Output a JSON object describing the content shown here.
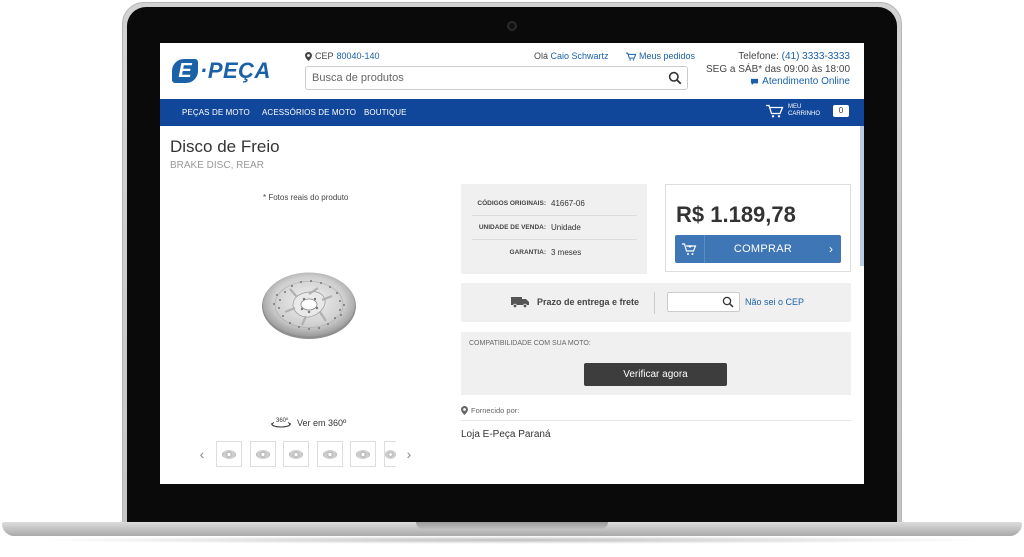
{
  "header": {
    "logo_e": "E",
    "logo_text": "·PEÇA",
    "cep_label": "CEP",
    "cep_value": "80040-140",
    "greeting_prefix": "Olá",
    "user_name": "Caio Schwartz",
    "orders_label": "Meus pedidos",
    "phone_label": "Telefone:",
    "phone_number": "(41) 3333-3333",
    "hours": "SEG a SÁB* das 09:00 às 18:00",
    "online_label": "Atendimento Online"
  },
  "search": {
    "placeholder": "Busca de produtos"
  },
  "nav": {
    "items": [
      "PEÇAS DE MOTO",
      "ACESSÓRIOS DE MOTO",
      "BOUTIQUE"
    ],
    "cart_line1": "MEU",
    "cart_line2": "CARRINHO",
    "cart_count": "0"
  },
  "product": {
    "title": "Disco de Freio",
    "subtitle": "BRAKE DISC, REAR",
    "photos_note": "* Fotos reais do produto",
    "view360_label": "Ver em 360º",
    "icon360_text": "360º",
    "thumb_count": 6
  },
  "info": {
    "rows": [
      {
        "label": "CÓDIGOS ORIGINAIS:",
        "value": "41667-06"
      },
      {
        "label": "UNIDADE DE VENDA:",
        "value": "Unidade"
      },
      {
        "label": "GARANTIA:",
        "value": "3 meses"
      }
    ]
  },
  "price": {
    "value": "R$ 1.189,78",
    "buy_label": "COMPRAR"
  },
  "shipping": {
    "label": "Prazo de entrega e frete",
    "cep_placeholder": "",
    "no_cep_link": "Não sei o CEP"
  },
  "compat": {
    "label": "COMPATIBILIDADE COM SUA MOTO:",
    "verify_label": "Verificar agora"
  },
  "supplier": {
    "label": "Fornecido por:",
    "name": "Loja E-Peça Paraná"
  },
  "colors": {
    "brand_blue": "#1b61a8",
    "nav_blue": "#11479b",
    "buy_blue": "#3f76b5",
    "verify_dark": "#3d3d3d"
  },
  "icons": [
    "pin-icon",
    "cart-icon",
    "search-icon",
    "chat-icon",
    "truck-icon",
    "rotate-360-icon",
    "chevron-left-icon",
    "chevron-right-icon"
  ]
}
